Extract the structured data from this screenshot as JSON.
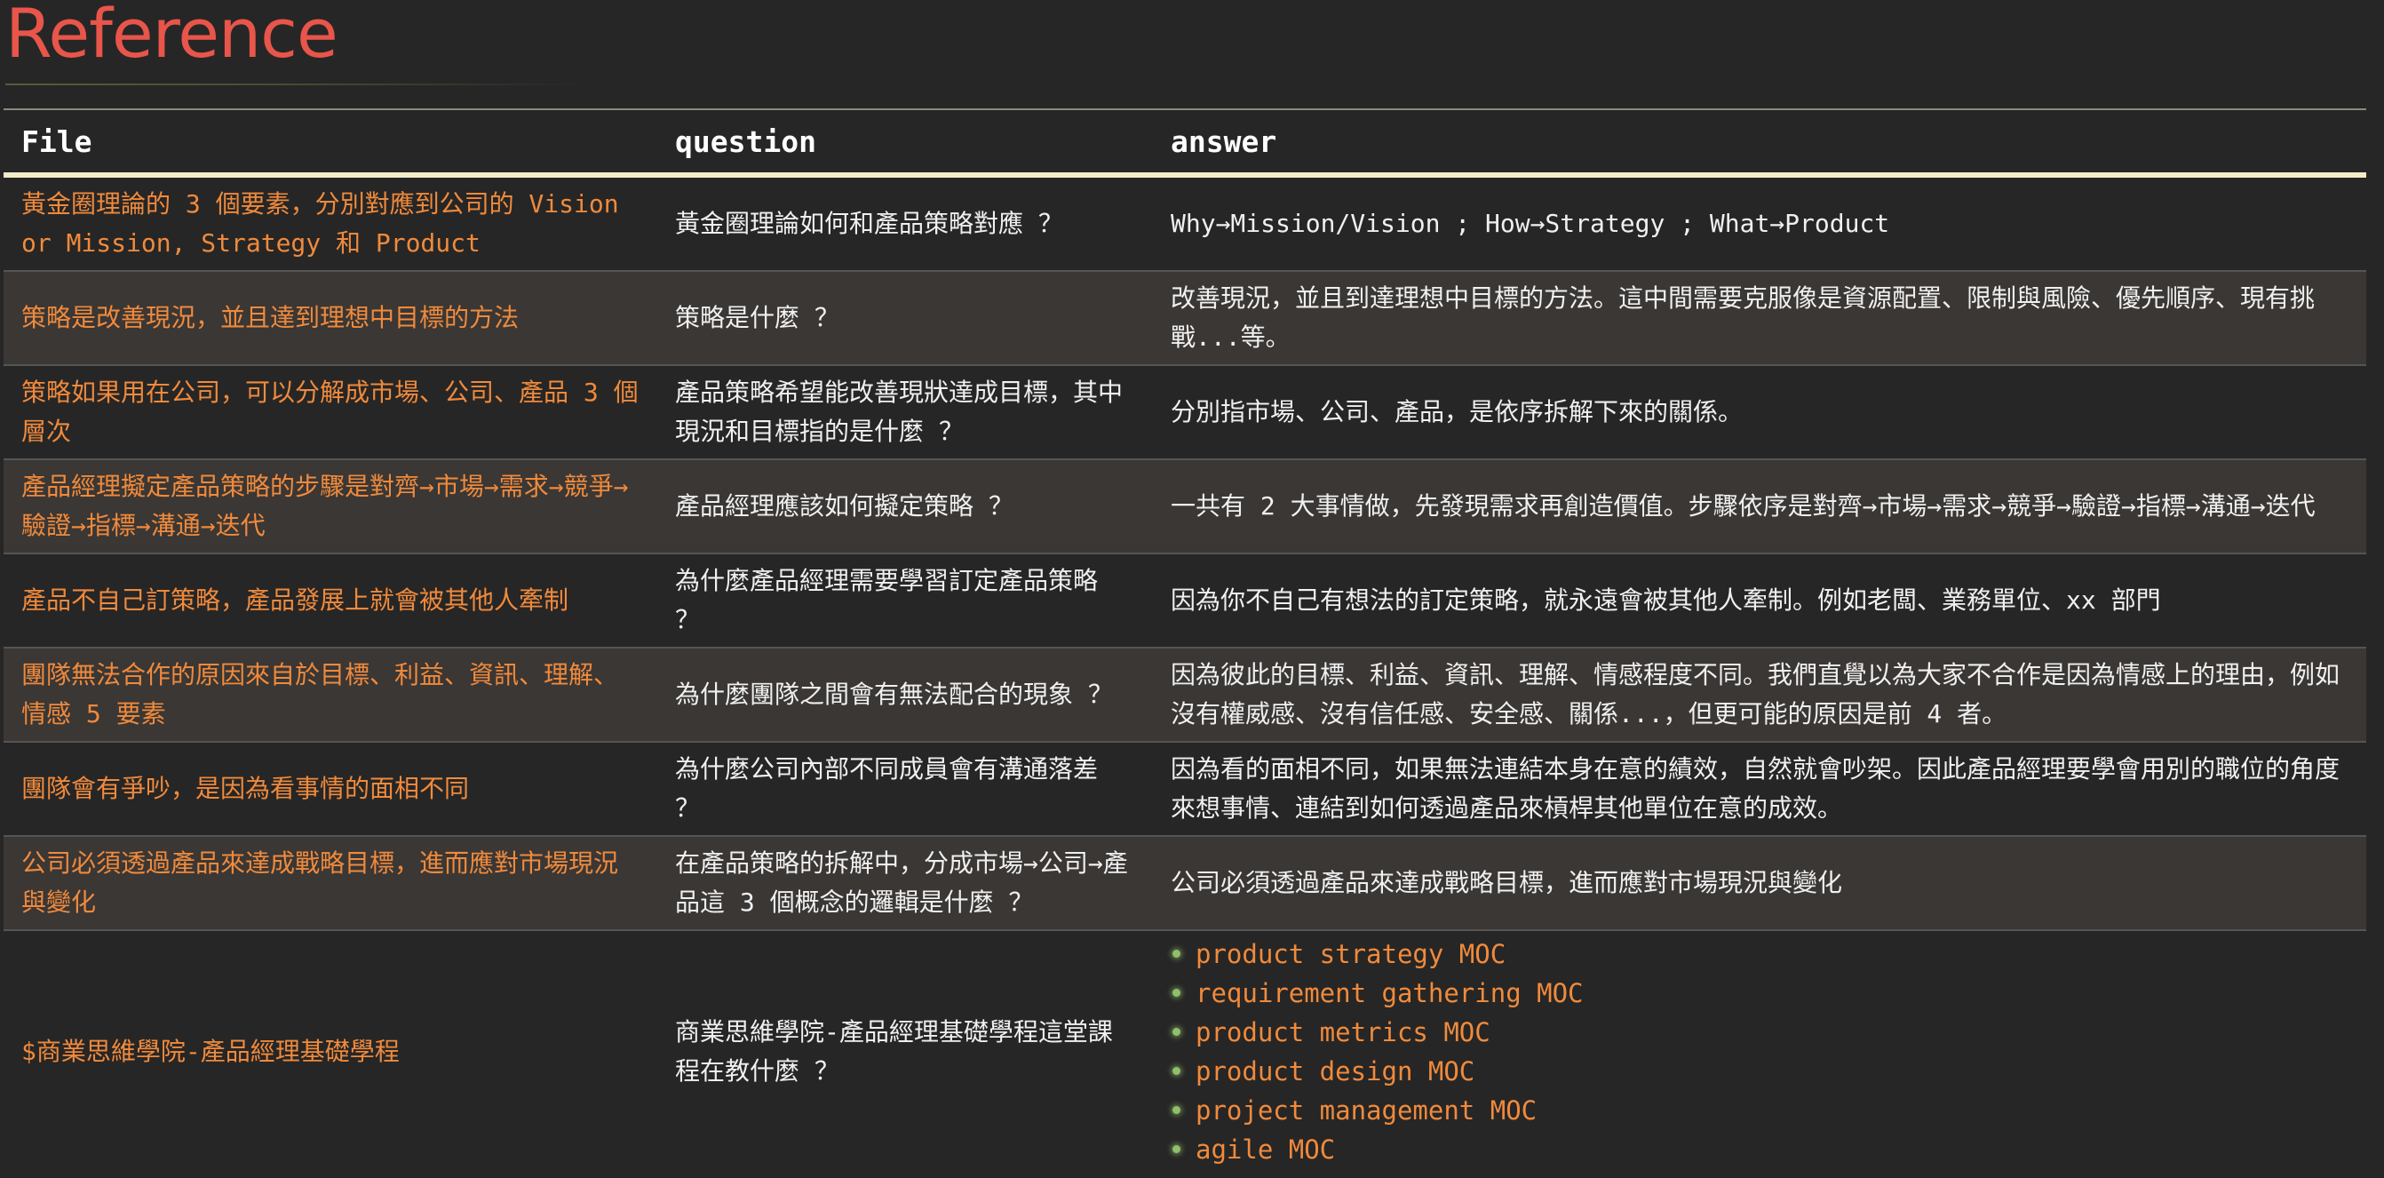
{
  "page": {
    "title": "Reference"
  },
  "table": {
    "headers": [
      "File",
      "question",
      "answer"
    ],
    "rows": [
      {
        "file": "黃金圈理論的 3 個要素，分別對應到公司的 Vision or Mission, Strategy 和 Product",
        "question": "黃金圈理論如何和產品策略對應 ？",
        "answer": "Why→Mission/Vision ; How→Strategy ; What→Product"
      },
      {
        "file": "策略是改善現況，並且達到理想中目標的方法",
        "question": "策略是什麼 ？",
        "answer": "改善現況，並且到達理想中目標的方法。這中間需要克服像是資源配置、限制與風險、優先順序、現有挑戰...等。"
      },
      {
        "file": "策略如果用在公司，可以分解成市場、公司、產品 3 個層次",
        "question": "產品策略希望能改善現狀達成目標，其中現況和目標指的是什麼 ？",
        "answer": "分別指市場、公司、產品，是依序拆解下來的關係。"
      },
      {
        "file": "產品經理擬定產品策略的步驟是對齊→市場→需求→競爭→驗證→指標→溝通→迭代",
        "question": "產品經理應該如何擬定策略 ？",
        "answer": "一共有 2 大事情做，先發現需求再創造價值。步驟依序是對齊→市場→需求→競爭→驗證→指標→溝通→迭代"
      },
      {
        "file": "產品不自己訂策略，產品發展上就會被其他人牽制",
        "question": "為什麼產品經理需要學習訂定產品策略 ？",
        "answer": "因為你不自己有想法的訂定策略，就永遠會被其他人牽制。例如老闆、業務單位、xx 部門"
      },
      {
        "file": "團隊無法合作的原因來自於目標、利益、資訊、理解、情感 5 要素",
        "question": "為什麼團隊之間會有無法配合的現象 ？",
        "answer": "因為彼此的目標、利益、資訊、理解、情感程度不同。我們直覺以為大家不合作是因為情感上的理由，例如沒有權威感、沒有信任感、安全感、關係...，但更可能的原因是前 4 者。"
      },
      {
        "file": "團隊會有爭吵，是因為看事情的面相不同",
        "question": "為什麼公司內部不同成員會有溝通落差 ？",
        "answer": "因為看的面相不同，如果無法連結本身在意的績效，自然就會吵架。因此產品經理要學會用別的職位的角度來想事情、連結到如何透過產品來槓桿其他單位在意的成效。"
      },
      {
        "file": "公司必須透過產品來達成戰略目標，進而應對市場現況與變化",
        "question": "在產品策略的拆解中，分成市場→公司→產品這 3 個概念的邏輯是什麼 ？",
        "answer": "公司必須透過產品來達成戰略目標，進而應對市場現況與變化"
      },
      {
        "file": "$商業思維學院-產品經理基礎學程",
        "question": "商業思維學院-產品經理基礎學程這堂課程在教什麼 ？",
        "answer_list": [
          "product strategy MOC",
          "requirement gathering MOC",
          "product metrics MOC",
          "product design MOC",
          "project management MOC",
          "agile MOC"
        ]
      }
    ]
  },
  "colors": {
    "title": "#e8554a",
    "file_link": "#f08a3c",
    "background": "#262626",
    "alt_row": "#3a3735",
    "header_rule": "#f3ecc8",
    "bullet": "#8fbf6a"
  }
}
